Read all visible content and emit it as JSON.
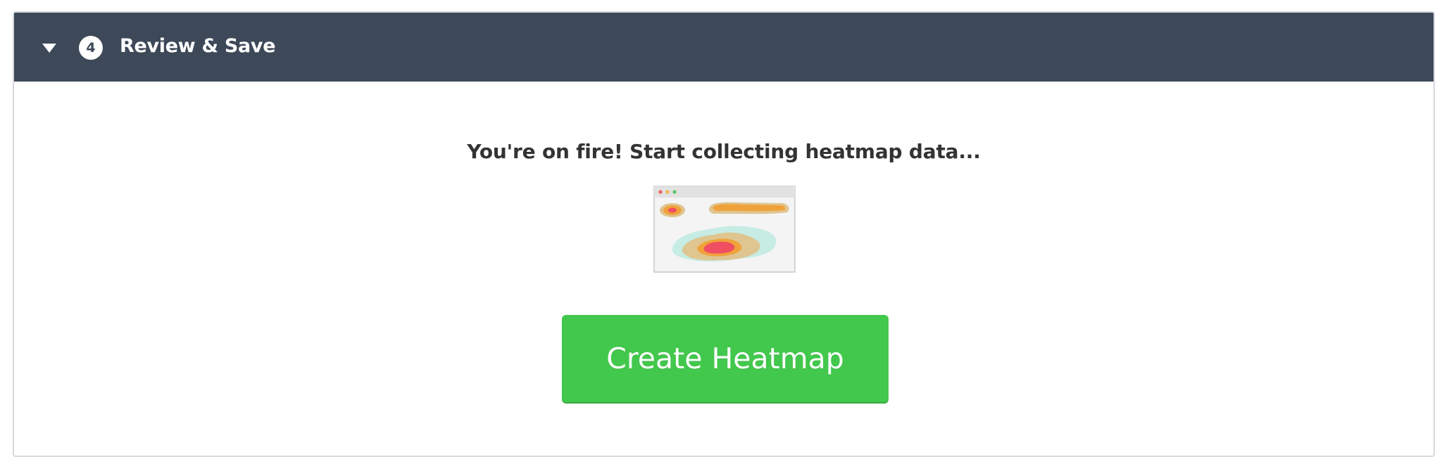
{
  "section": {
    "step_number": "4",
    "title": "Review & Save",
    "collapse_icon": "caret-down-icon"
  },
  "content": {
    "message": "You're on fire! Start collecting heatmap data...",
    "illustration_icon": "heatmap-browser-illustration",
    "create_button_label": "Create Heatmap"
  },
  "colors": {
    "header_bg": "#3d4858",
    "button_bg": "#42c84c",
    "heat_red": "#f04e62",
    "heat_orange": "#f0a23a",
    "heat_tan": "#dfc590",
    "heat_mint": "#c6ece4"
  }
}
